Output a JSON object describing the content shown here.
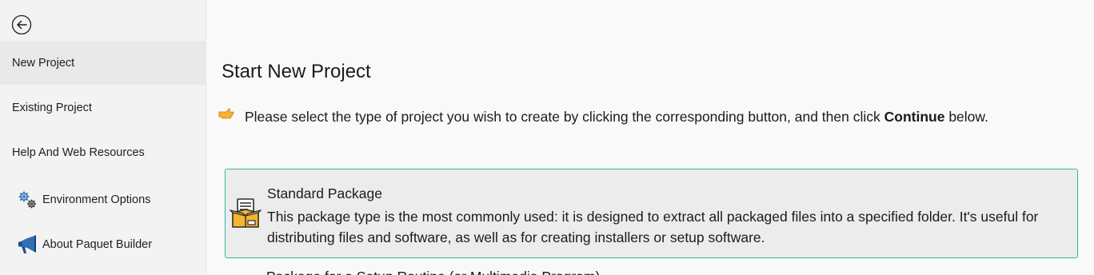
{
  "sidebar": {
    "back_icon": "back-arrow-circle-icon",
    "items": [
      {
        "label": "New Project",
        "selected": true
      },
      {
        "label": "Existing Project"
      },
      {
        "label": "Help And Web Resources"
      },
      {
        "label": "Environment Options",
        "icon": "gears-icon"
      },
      {
        "label": "About Paquet Builder",
        "icon": "megaphone-icon"
      }
    ]
  },
  "main": {
    "title": "Start New Project",
    "instruction": {
      "icon": "pointing-hand-icon",
      "before": "Please select the type of project you wish to create by clicking the corresponding button, and then click ",
      "bold": "Continue",
      "after": " below."
    },
    "options": [
      {
        "title": "Standard Package",
        "description": "This package type is the most commonly used: it is designed to extract all packaged files into a specified folder. It's useful for distributing files and software, as well as for creating installers or setup software.",
        "icon": "package-box-icon",
        "selected": true
      },
      {
        "title": "Package for a Setup Routine (or Multimedia Program)"
      }
    ]
  },
  "colors": {
    "selected_border": "#38b5a5",
    "sidebar_bg": "#f3f3f3",
    "selected_nav_bg": "#e9e9e9",
    "card_bg": "#ececec",
    "icon_blue": "#2e6fb5"
  }
}
